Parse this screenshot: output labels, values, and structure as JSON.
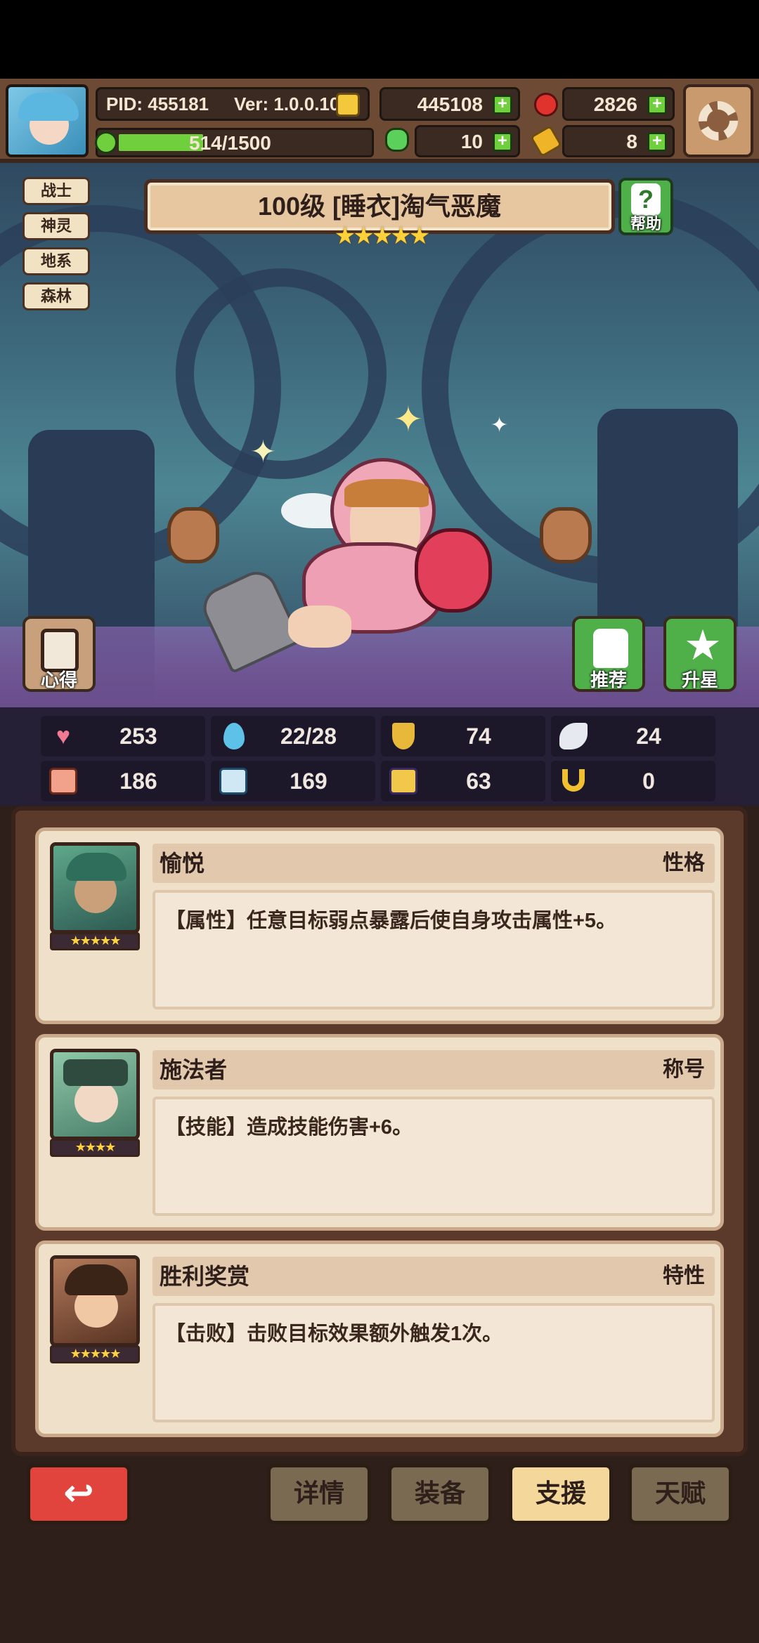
{
  "header": {
    "pid": "PID: 455181",
    "version": "Ver: 1.0.0.10",
    "exp": "514/1500",
    "exp_progress": 0.343,
    "gold": "445108",
    "gems": "2826",
    "clover": "10",
    "keys": "8"
  },
  "tags": [
    "战士",
    "神灵",
    "地系",
    "森林"
  ],
  "character": {
    "title": "100级 [睡衣]淘气恶魔",
    "stars": "★★★★★"
  },
  "buttons": {
    "help": "帮助",
    "insight": "心得",
    "recommend": "推荐",
    "star_up": "升星"
  },
  "stats": {
    "hp": "253",
    "mana": "22/28",
    "defense": "74",
    "speed": "24",
    "attack": "186",
    "magic": "169",
    "skill": "63",
    "luck": "0"
  },
  "supports": [
    {
      "name": "愉悦",
      "type": "性格",
      "desc": "【属性】任意目标弱点暴露后使自身攻击属性+5。",
      "stars": "★★★★★"
    },
    {
      "name": "施法者",
      "type": "称号",
      "desc": "【技能】造成技能伤害+6。",
      "stars": "★★★★"
    },
    {
      "name": "胜利奖赏",
      "type": "特性",
      "desc": "【击败】击败目标效果额外触发1次。",
      "stars": "★★★★★"
    }
  ],
  "nav": {
    "details": "详情",
    "equipment": "装备",
    "support": "支援",
    "talent": "天赋"
  },
  "colors": {
    "active_tab": "#f3d79b",
    "inactive_tab": "#7a6a52",
    "back_button": "#e0443c",
    "green_button": "#4fb04a"
  }
}
